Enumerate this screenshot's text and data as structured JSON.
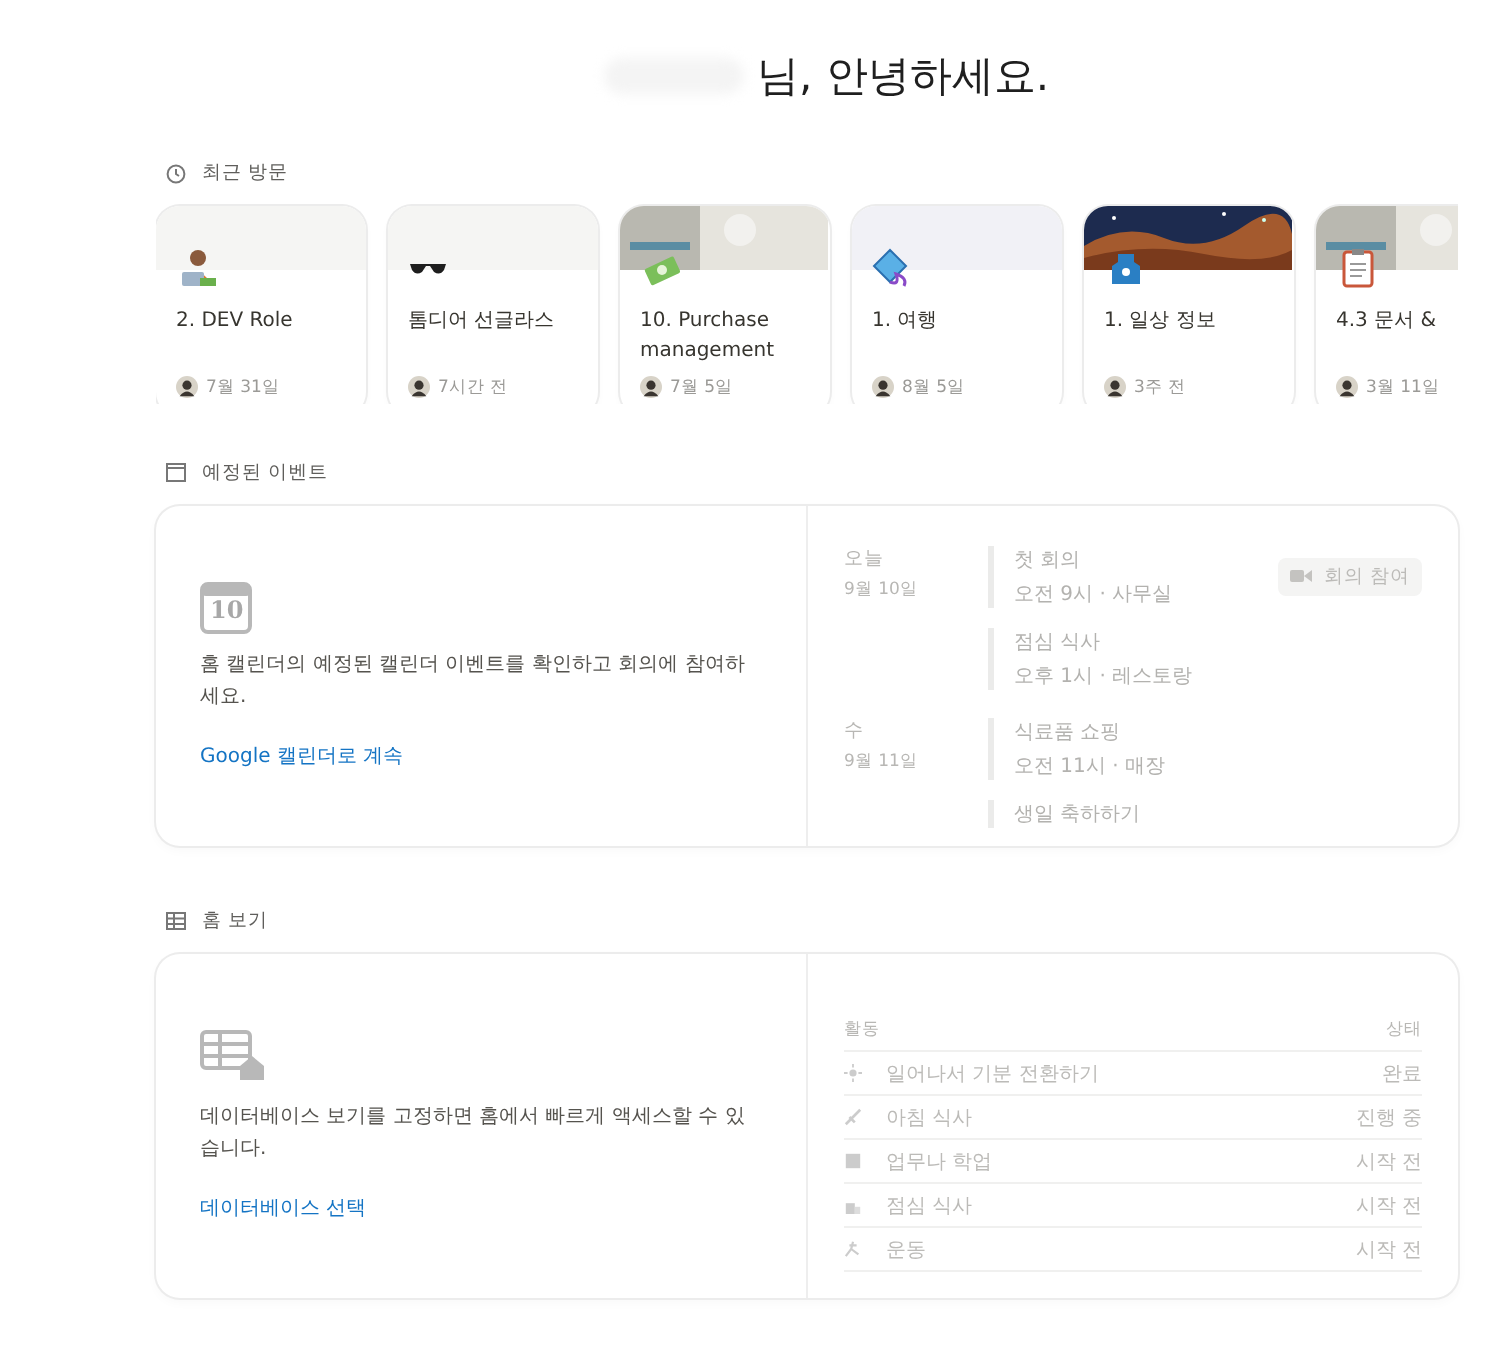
{
  "greeting": "님, 안녕하세요.",
  "recent": {
    "title": "최근 방문",
    "cards": [
      {
        "title": "2. DEV Role",
        "time": "7월 31일",
        "kind": "plain"
      },
      {
        "title": "톰디어 선글라스",
        "time": "7시간 전",
        "kind": "plain"
      },
      {
        "title": "10. Purchase management",
        "time": "7월 5일",
        "kind": "picture"
      },
      {
        "title": "1. 여행",
        "time": "8월 5일",
        "kind": "tint"
      },
      {
        "title": "1. 일상 정보",
        "time": "3주 전",
        "kind": "picture"
      },
      {
        "title": "4.3 문서 &",
        "time": "3월 11일",
        "kind": "picture"
      }
    ]
  },
  "events": {
    "title": "예정된 이벤트",
    "icon_label": "10",
    "message": "홈 캘린더의 예정된 캘린더 이벤트를 확인하고 회의에 참여하세요.",
    "link": "Google 캘린더로 계속",
    "days": [
      {
        "weekday": "오늘",
        "date": "9월 10일",
        "items": [
          {
            "title": "첫 회의",
            "detail": "오전 9시 · 사무실",
            "action": "회의 참여"
          },
          {
            "title": "점심 식사",
            "detail": "오후 1시 · 레스토랑"
          }
        ]
      },
      {
        "weekday": "수",
        "date": "9월 11일",
        "items": [
          {
            "title": "식료품 쇼핑",
            "detail": "오전 11시 · 매장"
          },
          {
            "title": "생일 축하하기"
          }
        ]
      }
    ]
  },
  "home_view": {
    "title": "홈 보기",
    "message": "데이터베이스 보기를 고정하면 홈에서 빠르게 액세스할 수 있습니다.",
    "link": "데이터베이스 선택",
    "columns": [
      "활동",
      "상태"
    ],
    "rows": [
      {
        "activity": "일어나서 기분 전환하기",
        "status": "완료"
      },
      {
        "activity": "아침 식사",
        "status": "진행 중"
      },
      {
        "activity": "업무나 학업",
        "status": "시작 전"
      },
      {
        "activity": "점심 식사",
        "status": "시작 전"
      },
      {
        "activity": "운동",
        "status": "시작 전"
      }
    ]
  }
}
